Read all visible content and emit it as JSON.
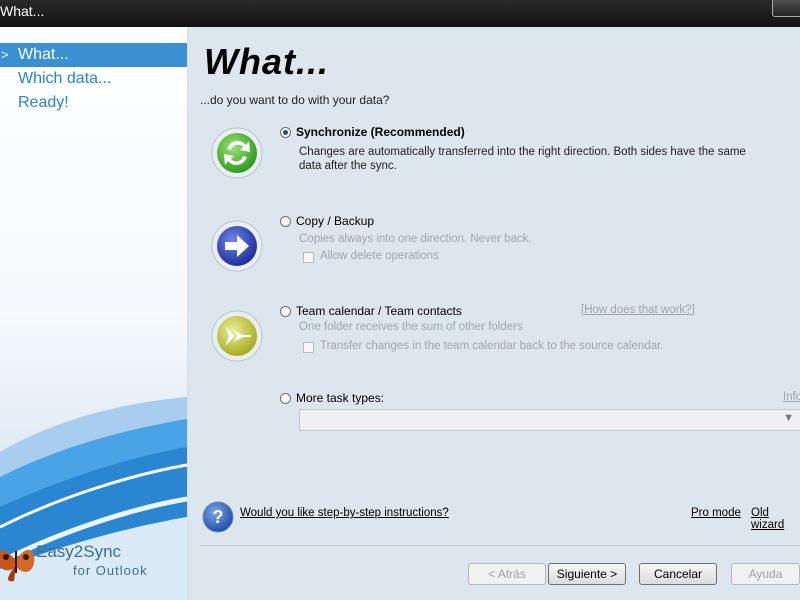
{
  "window": {
    "title": "What..."
  },
  "sidebar": {
    "steps": [
      {
        "label": "What...",
        "active": true
      },
      {
        "label": "Which data...",
        "active": false
      },
      {
        "label": "Ready!",
        "active": false
      }
    ],
    "step_arrow": ">",
    "brand": "Easy2Sync",
    "brand_sub": "for Outlook"
  },
  "main": {
    "heading": "What...",
    "subheading": "...do you want to do with your data?",
    "options": {
      "sync": {
        "label": "Synchronize (Recommended)",
        "desc_line1": "Changes are automatically transferred into the right direction. Both sides have the same",
        "desc_line2": "data after the sync.",
        "selected": true
      },
      "copy": {
        "label": "Copy / Backup",
        "desc": "Copies always into one direction. Never back.",
        "checkbox": "Allow delete operations",
        "selected": false
      },
      "team": {
        "label": "Team calendar / Team contacts",
        "desc": "One folder receives the sum of other folders",
        "checkbox": "Transfer changes in the team calendar back to the source calendar.",
        "link": "[How does that work?]",
        "selected": false
      },
      "more": {
        "label": "More task types:",
        "link": "Info",
        "selected": false
      }
    },
    "help_link": "Would you like step-by-step instructions?",
    "pro_mode": "Pro mode",
    "old_wizard": "Old wizard"
  },
  "footer": {
    "back": "< Atrás",
    "next": "Siguiente >",
    "cancel": "Cancelar",
    "help": "Ayuda"
  },
  "colors": {
    "accent": "#3b8fd3",
    "step_text": "#2c83c9",
    "panel_bg": "#dde5ef",
    "disabled_text": "#a0a6ae"
  }
}
